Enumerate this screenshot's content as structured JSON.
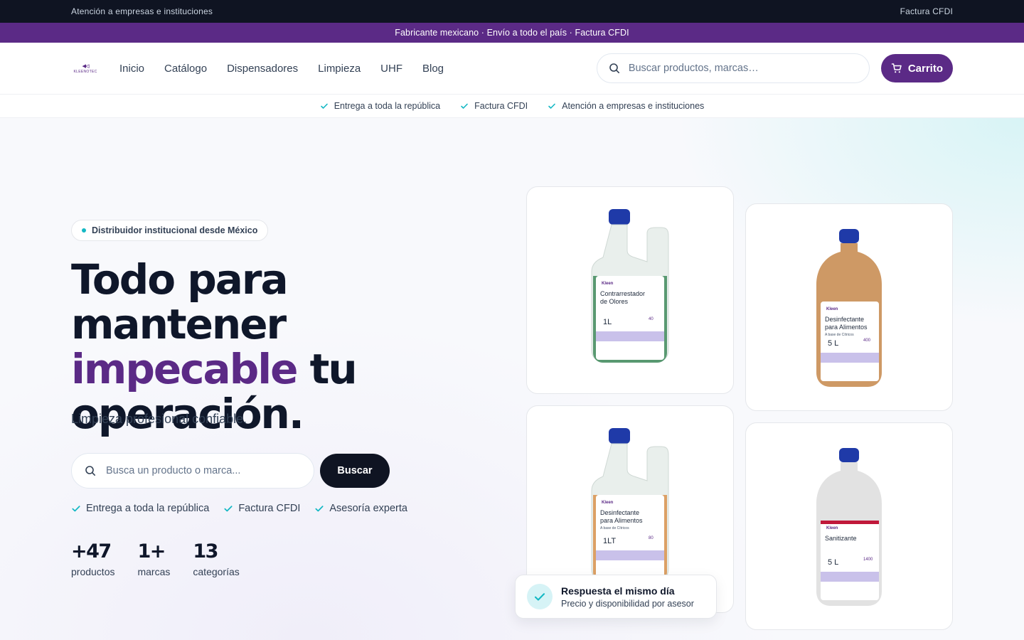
{
  "topbar": {
    "left": "Atención a empresas e instituciones",
    "right": "Factura CFDI"
  },
  "promo": {
    "text": "Fabricante mexicano · Envío a todo el país · Factura CFDI"
  },
  "nav": {
    "logo_text": "KLEENOTEC",
    "items": [
      "Inicio",
      "Catálogo",
      "Dispensadores",
      "Limpieza",
      "UHF",
      "Blog"
    ],
    "search_placeholder": "Buscar productos, marcas…",
    "cart_label": "Carrito"
  },
  "trustbar": [
    "Entrega a toda la república",
    "Factura CFDI",
    "Atención a empresas e instituciones"
  ],
  "hero": {
    "pill": "Distribuidor institucional desde México",
    "headline_1": "Todo para mantener",
    "headline_accent": "impecable",
    "headline_2": " tu",
    "headline_3": "operación.",
    "subtitle": "Limpieza profesional confiable.",
    "search_placeholder": "Busca un producto o marca...",
    "search_button": "Buscar",
    "features": [
      "Entrega a toda la república",
      "Factura CFDI",
      "Asesoría experta"
    ],
    "stats": [
      {
        "value": "+47",
        "label": "productos"
      },
      {
        "value": "1+",
        "label": "marcas"
      },
      {
        "value": "13",
        "label": "categorías"
      }
    ]
  },
  "products": [
    {
      "brand": "Kleen",
      "name_1": "Contrarrestador",
      "name_2": "de Olores",
      "sub": "",
      "volume": "1L",
      "doses": "40",
      "color": "#3f8a5c",
      "shape": "doser"
    },
    {
      "brand": "Kleen",
      "name_1": "Desinfectante",
      "name_2": "para Alimentos",
      "sub": "A base de Cítricos",
      "volume": "5 L",
      "doses": "400",
      "color": "#c6874a",
      "shape": "jug"
    },
    {
      "brand": "Kleen",
      "name_1": "Desinfectante",
      "name_2": "para Alimentos",
      "sub": "A base de Cítricos",
      "volume": "1LT",
      "doses": "80",
      "color": "#d9924e",
      "shape": "doser"
    },
    {
      "brand": "Kleen",
      "name_1": "Sanitizante",
      "name_2": "",
      "sub": "",
      "volume": "5 L",
      "doses": "1400",
      "color": "#eeeeee",
      "shape": "jug"
    }
  ],
  "toast": {
    "title": "Respuesta el mismo día",
    "subtitle": "Precio y disponibilidad por asesor"
  },
  "colors": {
    "brand": "#5b2a86",
    "dark": "#0f1422",
    "teal": "#14b8c4"
  }
}
